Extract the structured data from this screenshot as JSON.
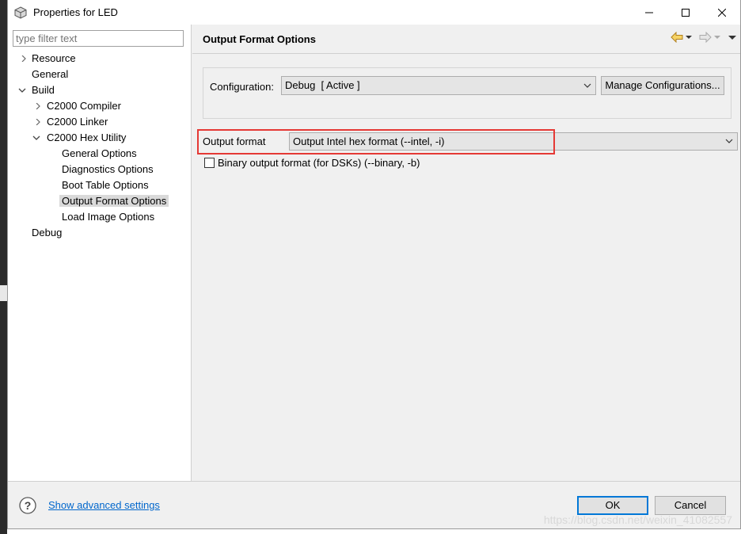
{
  "window": {
    "title": "Properties for LED"
  },
  "tree": {
    "filter_placeholder": "type filter text",
    "items": [
      {
        "label": "Resource"
      },
      {
        "label": "General"
      },
      {
        "label": "Build"
      },
      {
        "label": "C2000 Compiler"
      },
      {
        "label": "C2000 Linker"
      },
      {
        "label": "C2000 Hex Utility"
      },
      {
        "label": "General Options"
      },
      {
        "label": "Diagnostics Options"
      },
      {
        "label": "Boot Table Options"
      },
      {
        "label": "Output Format Options"
      },
      {
        "label": "Load Image Options"
      },
      {
        "label": "Debug"
      }
    ],
    "selected": "Output Format Options"
  },
  "page": {
    "title": "Output Format Options",
    "configuration_label": "Configuration:",
    "configuration_value": "Debug  [ Active ]",
    "manage_button": "Manage Configurations...",
    "output_format_label": "Output format",
    "output_format_value": "Output Intel hex format (--intel, -i)",
    "binary_checkbox_label": "Binary output format (for DSKs) (--binary, -b)",
    "binary_checked": false
  },
  "footer": {
    "advanced_link": "Show advanced settings",
    "ok_label": "OK",
    "cancel_label": "Cancel",
    "watermark": "https://blog.csdn.net/weixin_41082557"
  },
  "colors": {
    "highlight": "#e53935",
    "link": "#0066cc",
    "accent": "#0078d7"
  }
}
